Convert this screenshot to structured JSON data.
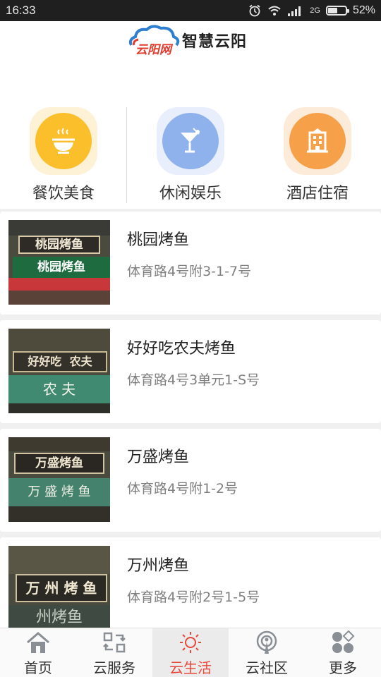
{
  "status_bar": {
    "time": "16:33",
    "battery": "52%",
    "network_label": "2G",
    "icons": [
      "alarm-icon",
      "wifi-icon",
      "signal-icon",
      "battery-icon"
    ]
  },
  "header": {
    "logo_text": "云阳网",
    "title": "智慧云阳"
  },
  "categories": [
    {
      "label": "餐饮美食",
      "icon": "noodle-bowl-icon",
      "color": "#fbbf2c",
      "halo": "#fdf1d6"
    },
    {
      "label": "休闲娱乐",
      "icon": "cocktail-icon",
      "color": "#8fb1ec",
      "halo": "#e8eefb"
    },
    {
      "label": "酒店住宿",
      "icon": "hotel-building-icon",
      "color": "#f7a04a",
      "halo": "#fdebd9"
    }
  ],
  "restaurants": [
    {
      "name": "桃园烤鱼",
      "address": "体育路4号附3-1-7号",
      "sign_text": "桃园烤鱼",
      "awning_text": "桃园烤鱼"
    },
    {
      "name": "好好吃农夫烤鱼",
      "address": "体育路4号3单元1-S号",
      "sign_text": "好好吃  农夫",
      "awning_text": "农 夫"
    },
    {
      "name": "万盛烤鱼",
      "address": "体育路4号附1-2号",
      "sign_text": "万盛烤鱼",
      "awning_text": "万 盛 烤 鱼"
    },
    {
      "name": "万州烤鱼",
      "address": "体育路4号附2号1-5号",
      "sign_text": "万 州 烤 鱼",
      "awning_text": "州烤鱼"
    }
  ],
  "bottom_nav": [
    {
      "label": "首页",
      "icon": "home-icon",
      "active": false
    },
    {
      "label": "云服务",
      "icon": "service-arrows-icon",
      "active": false
    },
    {
      "label": "云生活",
      "icon": "sun-icon",
      "active": true
    },
    {
      "label": "云社区",
      "icon": "community-pin-icon",
      "active": false
    },
    {
      "label": "更多",
      "icon": "more-dots-icon",
      "active": false
    }
  ],
  "colors": {
    "accent": "#e8473a",
    "status_bar": "#1f1f1f"
  }
}
